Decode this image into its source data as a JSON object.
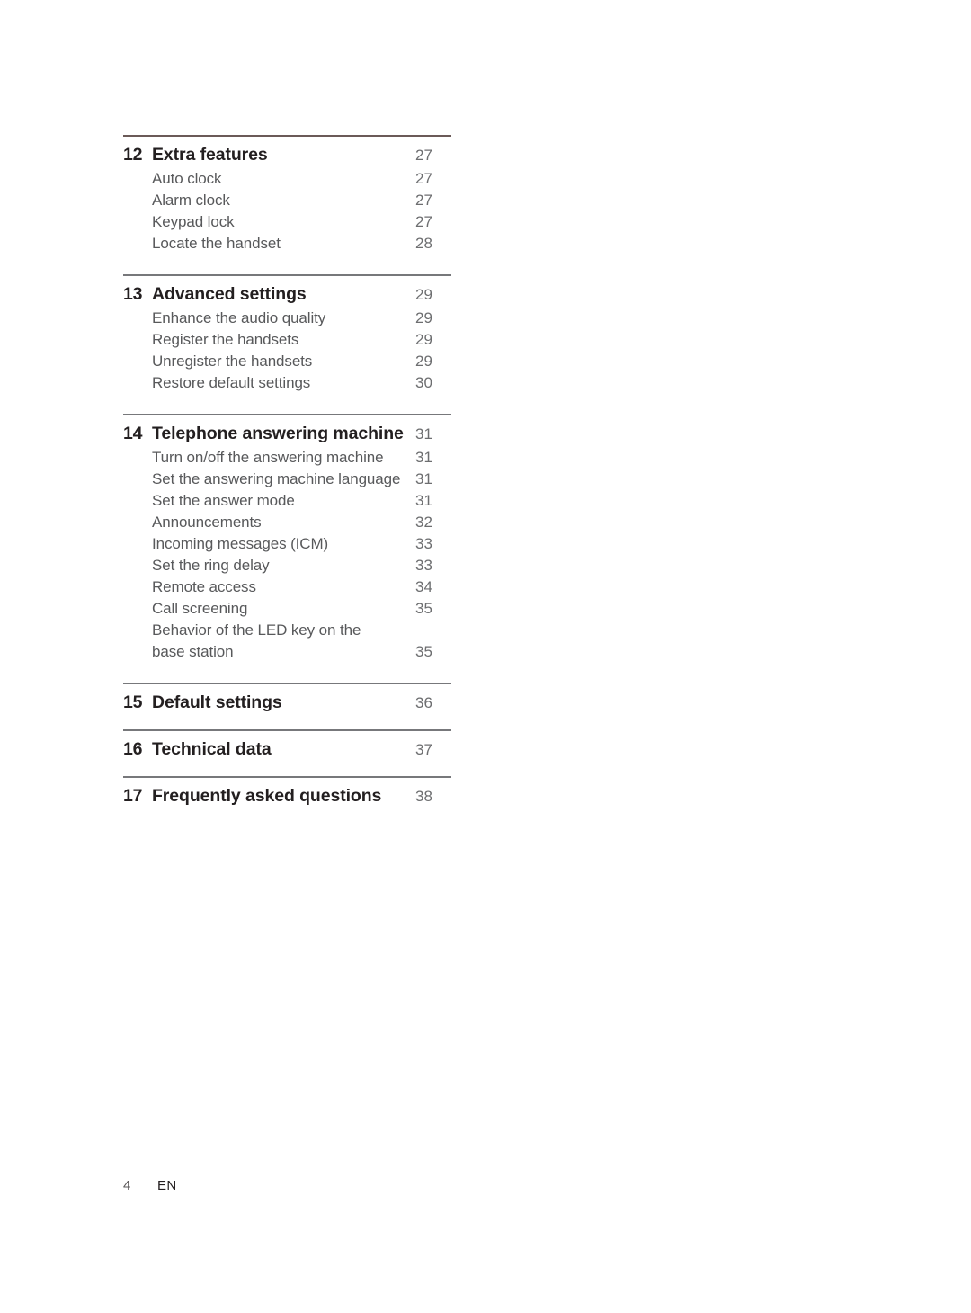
{
  "page": {
    "footer": {
      "number": "4",
      "language": "EN"
    }
  },
  "toc": {
    "sections": [
      {
        "number": "12",
        "title": "Extra features",
        "page": "27",
        "items": [
          {
            "label": "Auto clock",
            "page": "27"
          },
          {
            "label": "Alarm clock",
            "page": "27"
          },
          {
            "label": "Keypad lock",
            "page": "27"
          },
          {
            "label": "Locate the handset",
            "page": "28"
          }
        ]
      },
      {
        "number": "13",
        "title": "Advanced settings",
        "page": "29",
        "items": [
          {
            "label": "Enhance the audio quality",
            "page": "29"
          },
          {
            "label": "Register the handsets",
            "page": "29"
          },
          {
            "label": "Unregister the handsets",
            "page": "29"
          },
          {
            "label": "Restore default settings",
            "page": "30"
          }
        ]
      },
      {
        "number": "14",
        "title": "Telephone answering machine",
        "page": "31",
        "items": [
          {
            "label": "Turn on/off the answering machine",
            "page": "31"
          },
          {
            "label": "Set the answering machine language",
            "page": "31"
          },
          {
            "label": "Set the answer mode",
            "page": "31"
          },
          {
            "label": "Announcements",
            "page": "32"
          },
          {
            "label": "Incoming messages (ICM)",
            "page": "33"
          },
          {
            "label": "Set the ring delay",
            "page": "33"
          },
          {
            "label": "Remote access",
            "page": "34"
          },
          {
            "label": "Call screening",
            "page": "35"
          },
          {
            "label": "Behavior of the LED key on the",
            "page": ""
          },
          {
            "label": "base station",
            "page": "35"
          }
        ]
      },
      {
        "number": "15",
        "title": "Default settings",
        "page": "36",
        "items": []
      },
      {
        "number": "16",
        "title": "Technical data",
        "page": "37",
        "items": []
      },
      {
        "number": "17",
        "title": "Frequently asked questions",
        "page": "38",
        "items": []
      }
    ]
  }
}
